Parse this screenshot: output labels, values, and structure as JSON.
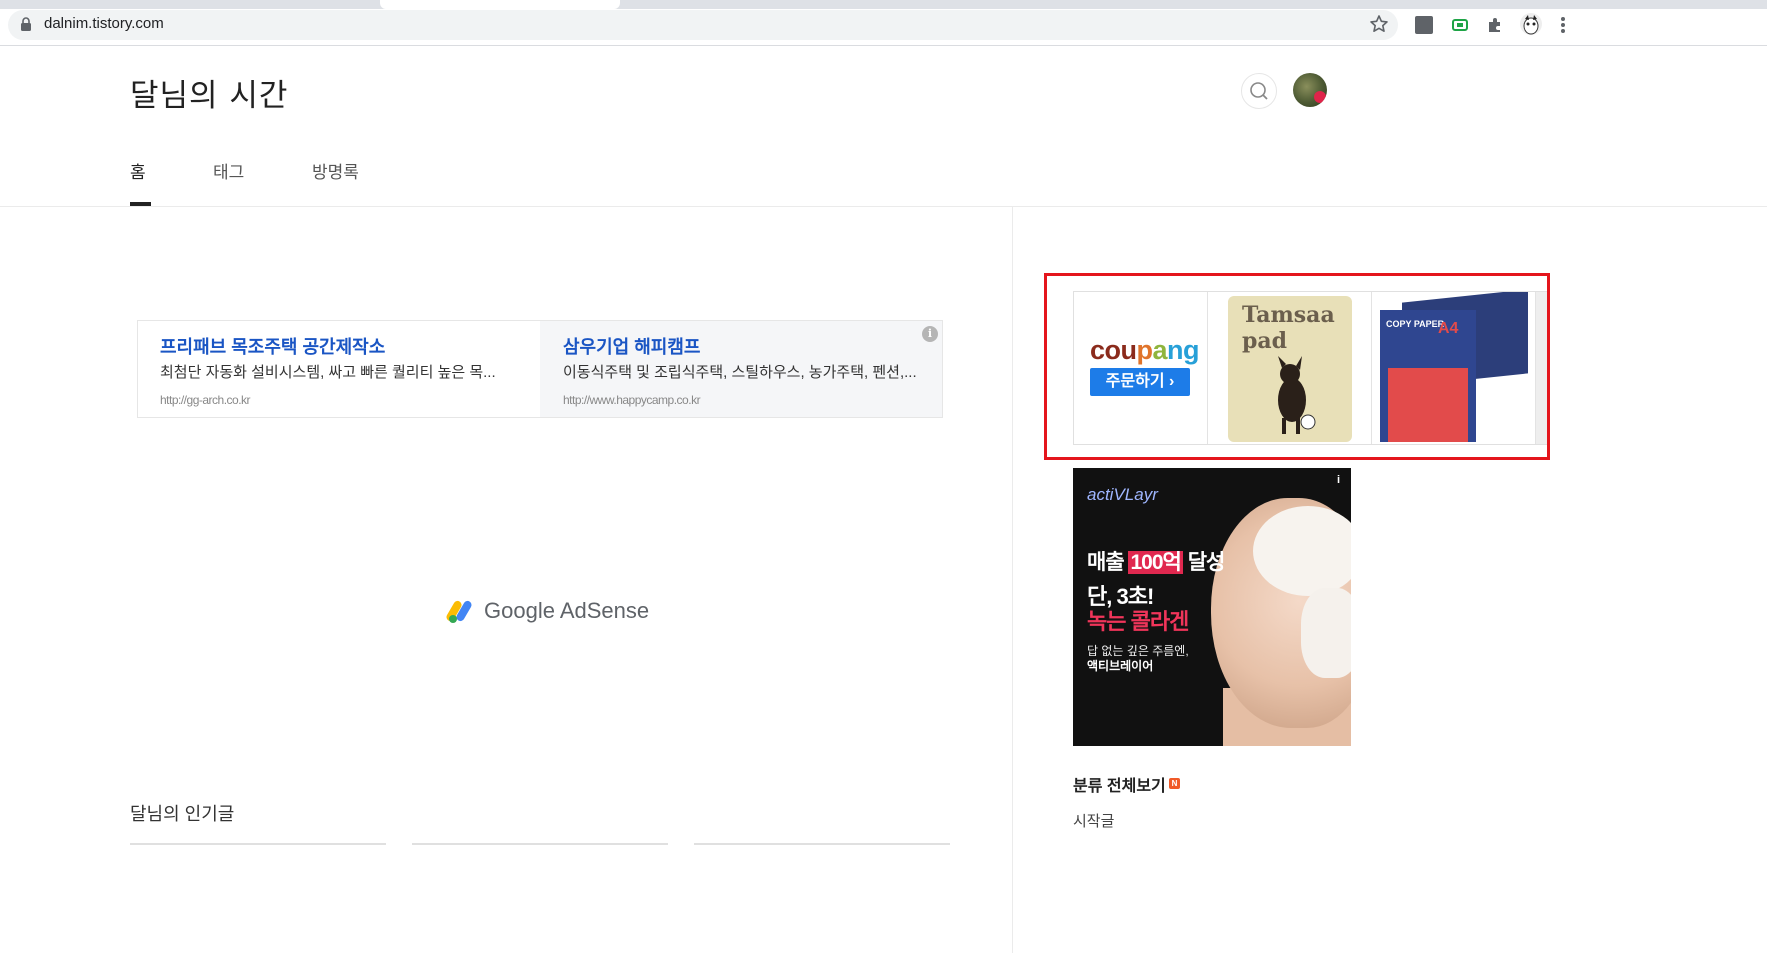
{
  "browser": {
    "url": "dalnim.tistory.com"
  },
  "blog": {
    "title": "달님의 시간",
    "nav": [
      "홈",
      "태그",
      "방명록"
    ]
  },
  "ads": {
    "left_title": "프리패브 목조주택 공간제작소",
    "left_desc": "최첨단 자동화 설비시스템, 싸고 빠른 퀄리티 높은 목...",
    "left_url": "http://gg-arch.co.kr",
    "right_title": "삼우기업 해피캠프",
    "right_desc": "이동식주택 및 조립식주택, 스틸하우스, 농가주택, 펜션,...",
    "right_url": "http://www.happycamp.co.kr",
    "info_icon": "i",
    "adsense_label": "Google AdSense"
  },
  "coupang": {
    "logo": "coupang",
    "button": "주문하기 ›",
    "pad_brand": "Tamsaa pad",
    "paper_label": "COPY PAPER",
    "paper_size": "A4"
  },
  "skin_ad": {
    "brand": "actiVLayr",
    "line1_a": "매출",
    "line1_b": "100억",
    "line1_c": "달성",
    "line2": "단, 3초!",
    "line3": "녹는 콜라겐",
    "sub1": "답 없는 깊은 주름엔,",
    "sub2": "액티브레이어",
    "info": "i"
  },
  "sidebar": {
    "category_title": "분류 전체보기",
    "new_badge": "N",
    "first_item": "시작글"
  },
  "popular": {
    "title": "달님의 인기글"
  },
  "colors": {
    "link_blue": "#1a55c4",
    "highlight_red": "#e4151c",
    "coupang_button": "#1d7ce8"
  }
}
